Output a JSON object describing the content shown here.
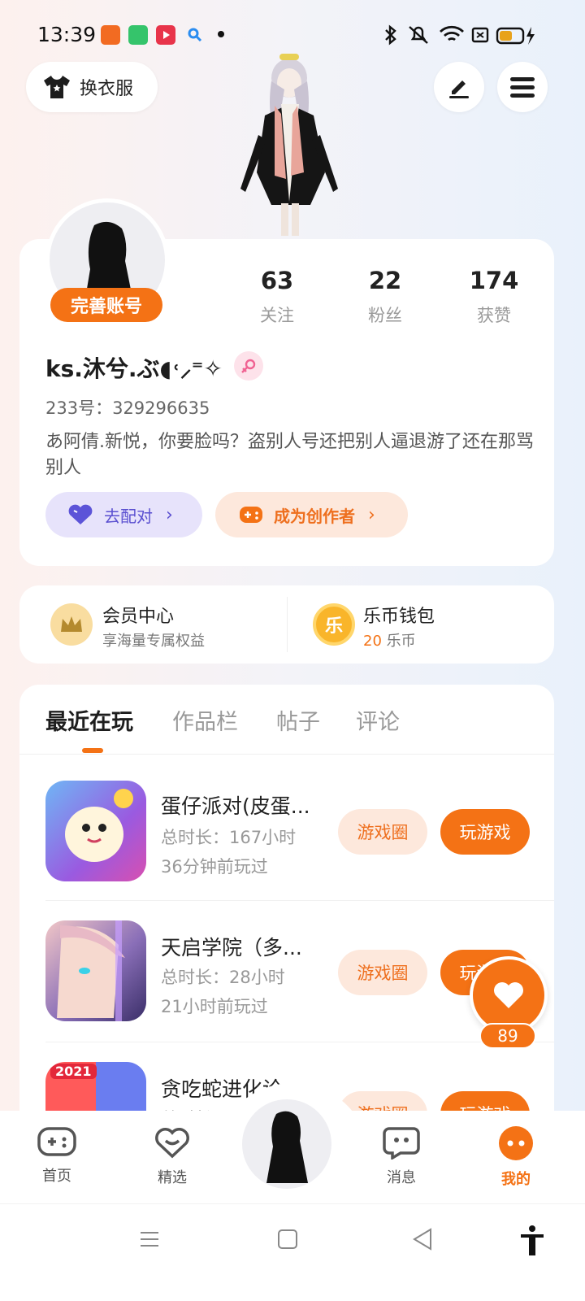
{
  "status_bar": {
    "time": "13:39"
  },
  "top": {
    "outfit_label": "换衣服"
  },
  "profile": {
    "complete_badge": "完善账号",
    "stats": [
      {
        "value": "63",
        "label": "关注"
      },
      {
        "value": "22",
        "label": "粉丝"
      },
      {
        "value": "174",
        "label": "获赞"
      }
    ],
    "nickname": "ks.沐兮.ぶ◖˓⸝⁼✧",
    "gender_icon": "female-icon",
    "id_line": "233号：329296635",
    "bio": "あ阿倩.新悦，你要脸吗？盗别人号还把别人逼退游了还在那骂别人",
    "match_label": "去配对",
    "creator_label": "成为创作者"
  },
  "vip": {
    "title": "会员中心",
    "sub": "享海量专属权益",
    "wallet_title": "乐币钱包",
    "wallet_amount": "20",
    "wallet_unit": "乐币",
    "wallet_coin_char": "乐"
  },
  "tabs": [
    {
      "label": "最近在玩",
      "active": true
    },
    {
      "label": "作品栏",
      "active": false
    },
    {
      "label": "帖子",
      "active": false
    },
    {
      "label": "评论",
      "active": false
    }
  ],
  "games": [
    {
      "title": "蛋仔派对(皮蛋...",
      "duration": "总时长：167小时",
      "last": "36分钟前玩过",
      "circle": "游戏圈",
      "play": "玩游戏"
    },
    {
      "title": "天启学院（多...",
      "duration": "总时长：28小时",
      "last": "21小时前玩过",
      "circle": "游戏圈",
      "play": "玩游戏"
    },
    {
      "title": "贪吃蛇进化论",
      "duration": "总时长",
      "last": "",
      "circle": "游戏圈",
      "play": "玩游戏",
      "badge": "2021"
    }
  ],
  "float_like": {
    "count": "89"
  },
  "bottom_nav": [
    {
      "label": "首页",
      "icon": "gamepad-icon"
    },
    {
      "label": "精选",
      "icon": "heart-chat-icon"
    },
    {
      "label": "",
      "icon": "avatar"
    },
    {
      "label": "消息",
      "icon": "message-icon"
    },
    {
      "label": "我的",
      "icon": "profile-icon"
    }
  ],
  "colors": {
    "accent": "#f47215",
    "purple": "#6a5fd8",
    "bg_light_orange": "#fde8dc"
  }
}
